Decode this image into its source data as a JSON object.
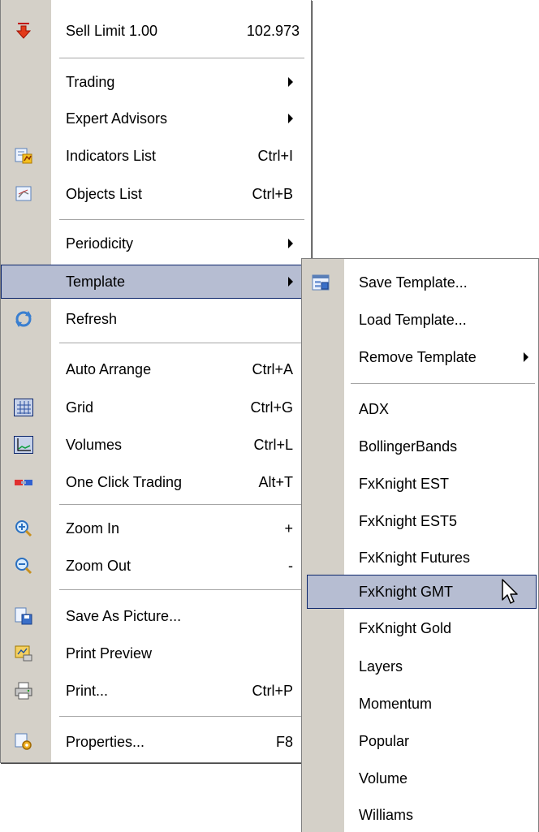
{
  "main_menu": {
    "sell_limit": {
      "label": "Sell Limit 1.00",
      "price": "102.973"
    },
    "trading": {
      "label": "Trading"
    },
    "expert_advisors": {
      "label": "Expert Advisors"
    },
    "indicators_list": {
      "label": "Indicators List",
      "shortcut": "Ctrl+I"
    },
    "objects_list": {
      "label": "Objects List",
      "shortcut": "Ctrl+B"
    },
    "periodicity": {
      "label": "Periodicity"
    },
    "template": {
      "label": "Template"
    },
    "refresh": {
      "label": "Refresh"
    },
    "auto_arrange": {
      "label": "Auto Arrange",
      "shortcut": "Ctrl+A"
    },
    "grid": {
      "label": "Grid",
      "shortcut": "Ctrl+G"
    },
    "volumes": {
      "label": "Volumes",
      "shortcut": "Ctrl+L"
    },
    "one_click_trading": {
      "label": "One Click Trading",
      "shortcut": "Alt+T"
    },
    "zoom_in": {
      "label": "Zoom In",
      "shortcut": "+"
    },
    "zoom_out": {
      "label": "Zoom Out",
      "shortcut": "-"
    },
    "save_as_picture": {
      "label": "Save As Picture..."
    },
    "print_preview": {
      "label": "Print Preview"
    },
    "print": {
      "label": "Print...",
      "shortcut": "Ctrl+P"
    },
    "properties": {
      "label": "Properties...",
      "shortcut": "F8"
    }
  },
  "template_submenu": {
    "save_template": {
      "label": "Save Template..."
    },
    "load_template": {
      "label": "Load Template..."
    },
    "remove_template": {
      "label": "Remove Template"
    },
    "templates": [
      "ADX",
      "BollingerBands",
      "FxKnight EST",
      "FxKnight EST5",
      "FxKnight Futures",
      "FxKnight GMT",
      "FxKnight Gold",
      "Layers",
      "Momentum",
      "Popular",
      "Volume",
      "Williams"
    ],
    "highlighted": "FxKnight GMT"
  },
  "colors": {
    "highlight_bg": "#b6bdd2",
    "highlight_border": "#0a246a",
    "gutter": "#d4d0c8"
  }
}
